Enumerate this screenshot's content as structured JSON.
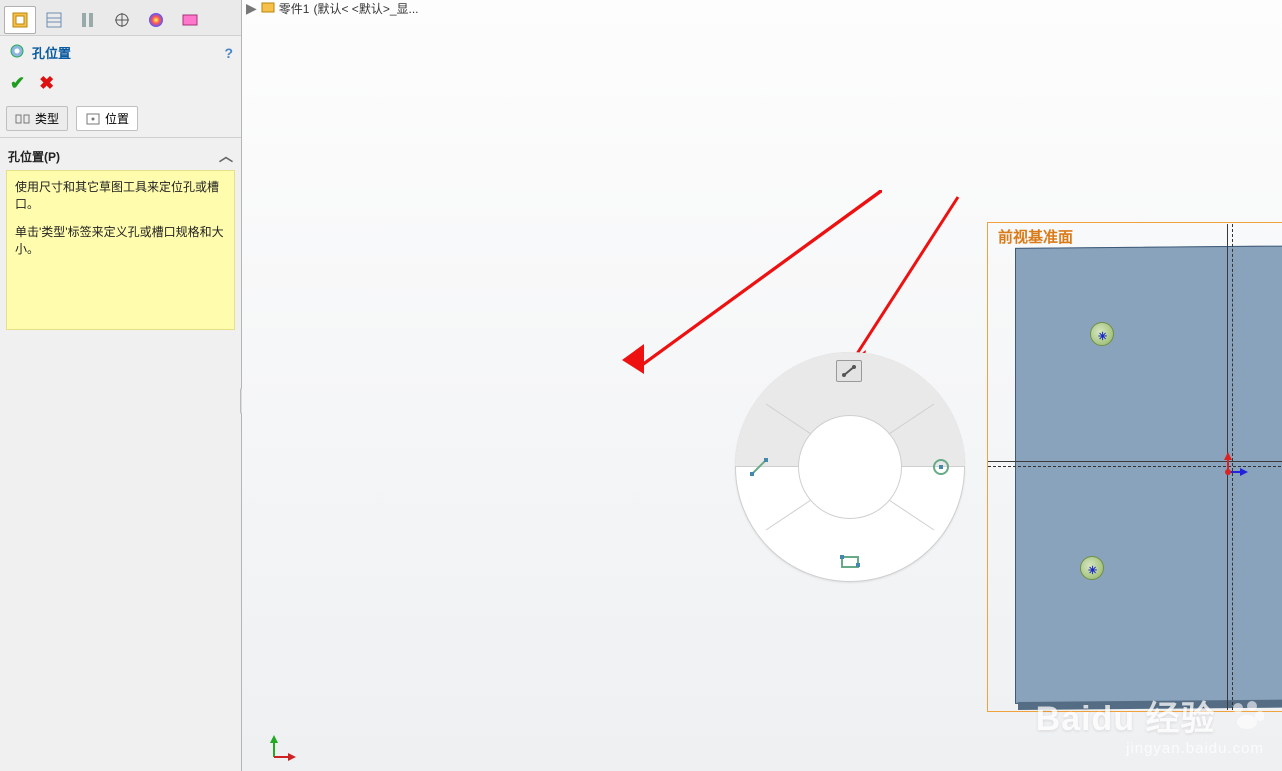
{
  "breadcrumb": {
    "part": "零件1",
    "config": "(默认< <默认>_显..."
  },
  "panel": {
    "feature_title": "孔位置",
    "tabs": {
      "type": "类型",
      "position": "位置"
    },
    "section": "孔位置(P)",
    "hint1": "使用尺寸和其它草图工具来定位孔或槽口。",
    "hint2": "单击'类型'标签来定义孔或槽口规格和大小。"
  },
  "viewport": {
    "plane_label": "前视基准面"
  },
  "watermark": {
    "brand": "Baidu 经验",
    "url": "jingyan.baidu.com"
  }
}
